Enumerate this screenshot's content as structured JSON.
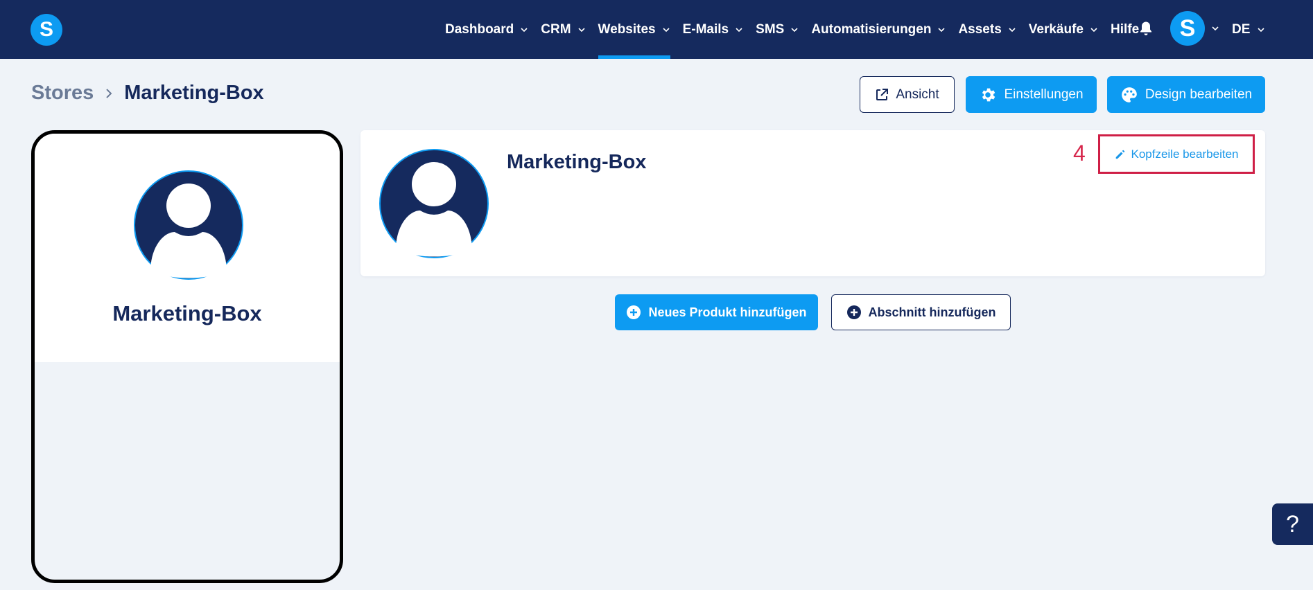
{
  "nav": {
    "logo_letter": "S",
    "items": [
      {
        "label": "Dashboard",
        "has_dropdown": true,
        "active": false
      },
      {
        "label": "CRM",
        "has_dropdown": true,
        "active": false
      },
      {
        "label": "Websites",
        "has_dropdown": true,
        "active": true
      },
      {
        "label": "E-Mails",
        "has_dropdown": true,
        "active": false
      },
      {
        "label": "SMS",
        "has_dropdown": true,
        "active": false
      },
      {
        "label": "Automatisierungen",
        "has_dropdown": true,
        "active": false
      },
      {
        "label": "Assets",
        "has_dropdown": true,
        "active": false
      },
      {
        "label": "Verkäufe",
        "has_dropdown": true,
        "active": false
      },
      {
        "label": "Hilfe",
        "has_dropdown": false,
        "active": false
      }
    ],
    "notification_icon": "bell-icon",
    "avatar_letter": "S",
    "language": "DE"
  },
  "breadcrumb": {
    "root": "Stores",
    "current": "Marketing-Box"
  },
  "toolbar": {
    "view_label": "Ansicht",
    "settings_label": "Einstellungen",
    "design_label": "Design bearbeiten"
  },
  "preview": {
    "store_name": "Marketing-Box"
  },
  "header_card": {
    "title": "Marketing-Box",
    "step_number": "4",
    "edit_header_label": "Kopfzeile bearbeiten"
  },
  "actions": {
    "add_product_label": "Neues Produkt hinzufügen",
    "add_section_label": "Abschnitt hinzufügen"
  },
  "help": {
    "label": "?"
  },
  "colors": {
    "navy": "#152a5e",
    "accent": "#0d9bf2",
    "background": "#eff3f8",
    "highlight": "#cf1f46"
  }
}
